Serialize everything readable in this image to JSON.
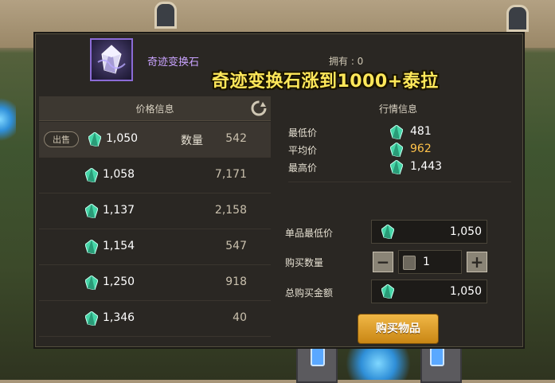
{
  "item": {
    "name": "奇迹变换石",
    "owned_label": "拥有 : 0"
  },
  "banner_text": "奇迹变换石涨到1000+泰拉",
  "price_panel": {
    "title": "价格信息",
    "sell_label": "出售",
    "qty_label": "数量",
    "rows": [
      {
        "price": "1,050",
        "qty": "542"
      },
      {
        "price": "1,058",
        "qty": "7,171"
      },
      {
        "price": "1,137",
        "qty": "2,158"
      },
      {
        "price": "1,154",
        "qty": "547"
      },
      {
        "price": "1,250",
        "qty": "918"
      },
      {
        "price": "1,346",
        "qty": "40"
      }
    ]
  },
  "market_panel": {
    "title": "行情信息",
    "min_label": "最低价",
    "min_value": "481",
    "avg_label": "平均价",
    "avg_value": "962",
    "max_label": "最高价",
    "max_value": "1,443"
  },
  "purchase": {
    "unit_min_label": "单品最低价",
    "unit_min_value": "1,050",
    "buy_qty_label": "购买数量",
    "buy_qty_value": "1",
    "total_label": "总购买金额",
    "total_value": "1,050",
    "buy_button": "购买物品",
    "minus": "−",
    "plus": "+"
  },
  "colors": {
    "gem": "#46d6a8",
    "item_name": "#c9a3ff",
    "avg_price": "#ffc24a",
    "banner": "#ffe85a",
    "buy_button": "#e3a230"
  }
}
